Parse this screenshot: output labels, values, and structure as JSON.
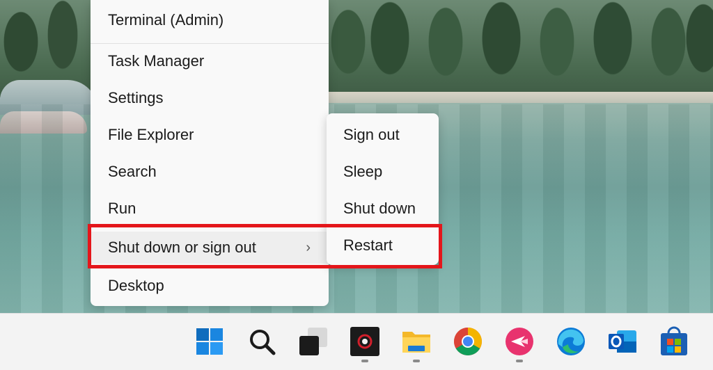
{
  "menu": {
    "items": [
      {
        "label": "Terminal (Admin)"
      },
      {
        "label": "Task Manager"
      },
      {
        "label": "Settings"
      },
      {
        "label": "File Explorer"
      },
      {
        "label": "Search"
      },
      {
        "label": "Run"
      },
      {
        "label": "Shut down or sign out",
        "has_submenu": true,
        "chevron": "›"
      },
      {
        "label": "Desktop"
      }
    ]
  },
  "submenu": {
    "items": [
      {
        "label": "Sign out"
      },
      {
        "label": "Sleep"
      },
      {
        "label": "Shut down"
      },
      {
        "label": "Restart"
      }
    ]
  },
  "taskbar": {
    "icons": [
      {
        "name": "windows-start-icon",
        "running": false
      },
      {
        "name": "search-icon",
        "running": false
      },
      {
        "name": "task-view-icon",
        "running": false
      },
      {
        "name": "camera-app-icon",
        "running": true
      },
      {
        "name": "file-explorer-icon",
        "running": true
      },
      {
        "name": "chrome-icon",
        "running": false
      },
      {
        "name": "app-pink-icon",
        "running": true
      },
      {
        "name": "edge-icon",
        "running": false
      },
      {
        "name": "outlook-icon",
        "running": false
      },
      {
        "name": "microsoft-store-icon",
        "running": false
      }
    ]
  },
  "colors": {
    "highlight": "#e4161b",
    "menu_bg": "#f9f9f9",
    "taskbar_bg": "#f3f3f3"
  }
}
